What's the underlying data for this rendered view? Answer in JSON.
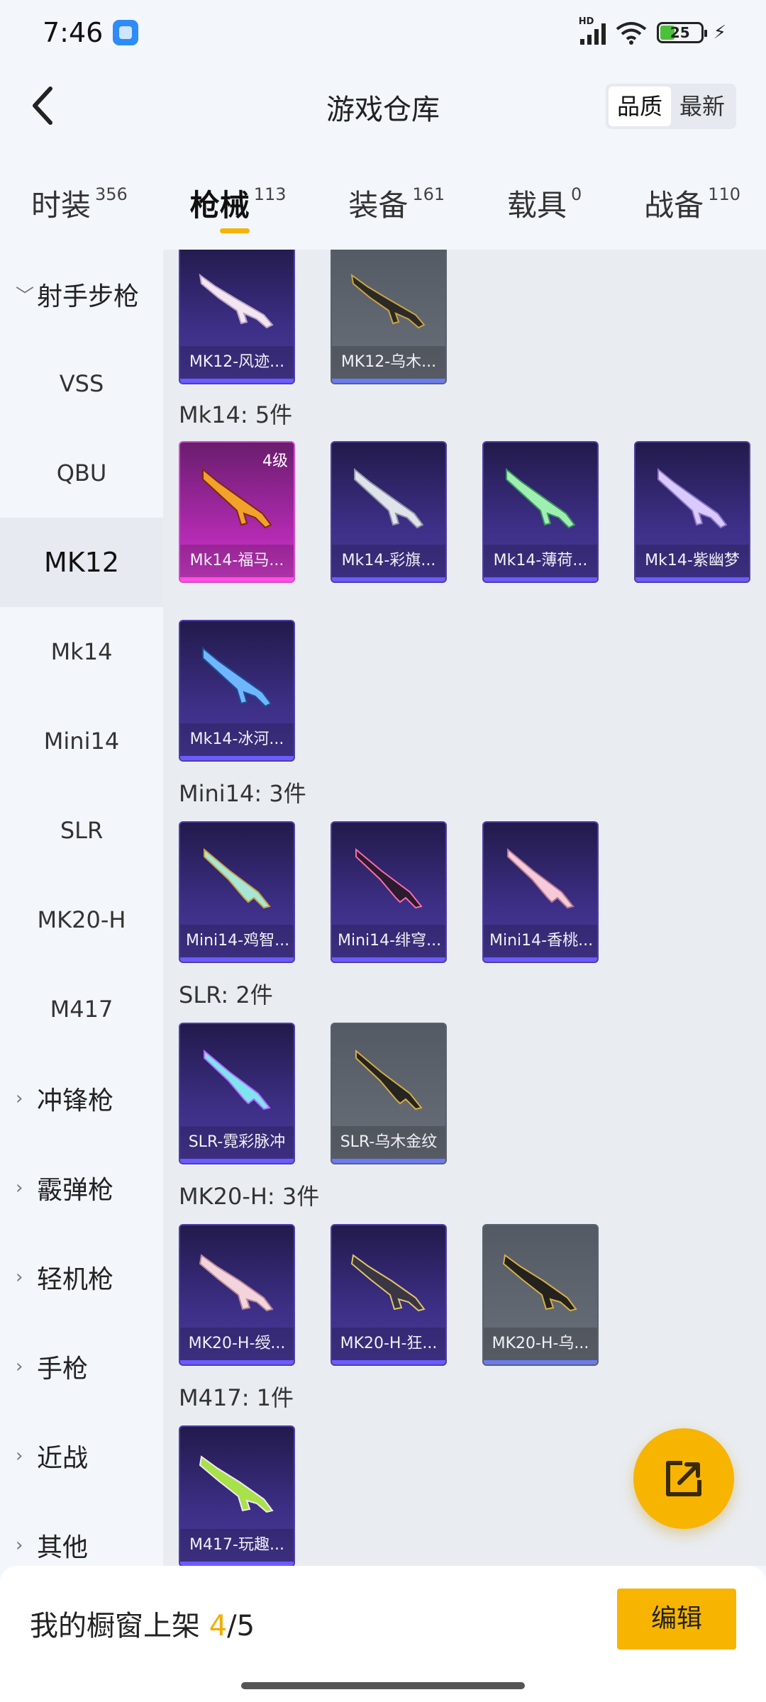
{
  "status_bar": {
    "time": "7:46",
    "battery": "25",
    "network": "HD"
  },
  "header": {
    "title": "游戏仓库",
    "sort_options": [
      "品质",
      "最新"
    ],
    "sort_selected": "品质"
  },
  "tabs": [
    {
      "label": "时装",
      "count": "356"
    },
    {
      "label": "枪械",
      "count": "113",
      "active": true
    },
    {
      "label": "装备",
      "count": "161"
    },
    {
      "label": "载具",
      "count": "0"
    },
    {
      "label": "战备",
      "count": "110"
    }
  ],
  "sidebar": [
    {
      "label": "射手步枪",
      "group": true,
      "expanded": true
    },
    {
      "label": "VSS"
    },
    {
      "label": "QBU"
    },
    {
      "label": "MK12",
      "selected": true
    },
    {
      "label": "Mk14"
    },
    {
      "label": "Mini14"
    },
    {
      "label": "SLR"
    },
    {
      "label": "MK20-H"
    },
    {
      "label": "M417"
    },
    {
      "label": "冲锋枪",
      "group": true
    },
    {
      "label": "霰弹枪",
      "group": true
    },
    {
      "label": "轻机枪",
      "group": true
    },
    {
      "label": "手枪",
      "group": true
    },
    {
      "label": "近战",
      "group": true
    },
    {
      "label": "其他",
      "group": true
    }
  ],
  "sections": [
    {
      "label": "",
      "items": [
        {
          "name": "MK12-风迹...",
          "style": "purple"
        },
        {
          "name": "MK12-乌木...",
          "style": "grey"
        }
      ]
    },
    {
      "label": "Mk14: 5件",
      "items": [
        {
          "name": "Mk14-福马...",
          "style": "pink",
          "grade": "4级"
        },
        {
          "name": "Mk14-彩旗...",
          "style": "purple"
        },
        {
          "name": "Mk14-薄荷...",
          "style": "purple"
        },
        {
          "name": "Mk14-紫幽梦",
          "style": "purple"
        },
        {
          "name": "Mk14-冰河...",
          "style": "purple"
        }
      ]
    },
    {
      "label": "Mini14: 3件",
      "items": [
        {
          "name": "Mini14-鸡智...",
          "style": "purple"
        },
        {
          "name": "Mini14-绯穹...",
          "style": "purple"
        },
        {
          "name": "Mini14-香桃...",
          "style": "purple"
        }
      ]
    },
    {
      "label": "SLR: 2件",
      "items": [
        {
          "name": "SLR-霓彩脉冲",
          "style": "purple"
        },
        {
          "name": "SLR-乌木金纹",
          "style": "grey"
        }
      ]
    },
    {
      "label": "MK20-H: 3件",
      "items": [
        {
          "name": "MK20-H-绶...",
          "style": "purple"
        },
        {
          "name": "MK20-H-狂...",
          "style": "purple"
        },
        {
          "name": "MK20-H-乌...",
          "style": "grey"
        }
      ]
    },
    {
      "label": "M417: 1件",
      "items": [
        {
          "name": "M417-玩趣...",
          "style": "purple"
        }
      ]
    }
  ],
  "bottom": {
    "showcase_label": "我的橱窗上架",
    "current": "4",
    "total": "/5",
    "edit_label": "编辑"
  },
  "colors": {
    "accent": "#f7b400",
    "rare_purple": "#3d2f86",
    "legendary_pink": "#b52bb4",
    "common_grey": "#5b6170"
  },
  "icons": {
    "back": "chevron-left-icon",
    "share": "share-out-icon"
  }
}
